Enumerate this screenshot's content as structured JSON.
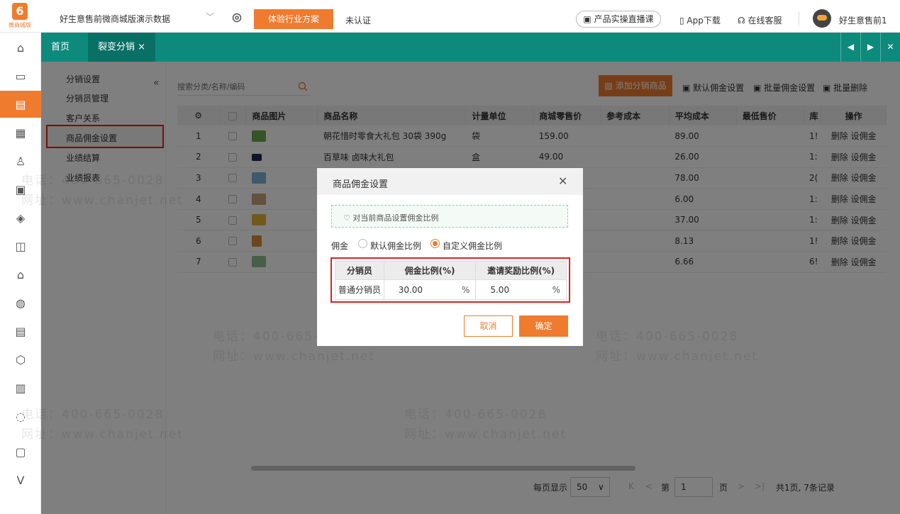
{
  "top": {
    "logo_text": "微商城版",
    "shop_name": "好生意售前微商城版演示数据",
    "industry_button": "体验行业方案",
    "cert_status": "未认证",
    "live_course": "产品实操直播课",
    "app_download": "App下载",
    "online_service": "在线客服",
    "username": "好生意售前1"
  },
  "tabs": [
    {
      "label": "首页"
    },
    {
      "label": "裂变分销"
    }
  ],
  "submenu": [
    {
      "label": "分销设置"
    },
    {
      "label": "分销员管理"
    },
    {
      "label": "客户关系"
    },
    {
      "label": "商品佣金设置"
    },
    {
      "label": "业绩结算"
    },
    {
      "label": "业绩报表"
    }
  ],
  "toolbar": {
    "search_placeholder": "搜索分类/名称/编码",
    "add_button": "添加分销商品",
    "default_commission": "默认佣金设置",
    "batch_commission": "批量佣金设置",
    "batch_delete": "批量删除"
  },
  "table": {
    "headers": [
      "商品图片",
      "商品名称",
      "计量单位",
      "商城零售价",
      "参考成本",
      "平均成本",
      "最低售价",
      "库",
      "操作"
    ],
    "rows": [
      {
        "no": "1",
        "name": "朝花惜时零食大礼包 30袋 390g",
        "unit": "袋",
        "price": "159.00",
        "avg": "89.00",
        "stock": "1!",
        "del": "删除",
        "set": "设佣金"
      },
      {
        "no": "2",
        "name": "百草味 卤味大礼包",
        "unit": "盒",
        "price": "49.00",
        "avg": "26.00",
        "stock": "1:",
        "del": "删除",
        "set": "设佣金"
      },
      {
        "no": "3",
        "name": "",
        "unit": "",
        "price": "",
        "avg": "78.00",
        "stock": "2(",
        "del": "删除",
        "set": "设佣金"
      },
      {
        "no": "4",
        "name": "",
        "unit": "",
        "price": "",
        "avg": "6.00",
        "stock": "1:",
        "del": "删除",
        "set": "设佣金"
      },
      {
        "no": "5",
        "name": "",
        "unit": "",
        "price": "",
        "avg": "37.00",
        "stock": "1:",
        "del": "删除",
        "set": "设佣金"
      },
      {
        "no": "6",
        "name": "",
        "unit": "",
        "price": "",
        "avg": "8.13",
        "stock": "1!",
        "del": "删除",
        "set": "设佣金"
      },
      {
        "no": "7",
        "name": "",
        "unit": "",
        "price": "",
        "avg": "6.66",
        "stock": "6!",
        "del": "删除",
        "set": "设佣金"
      }
    ]
  },
  "pager": {
    "per_page_label": "每页显示",
    "per_page": "50",
    "page_prefix": "第",
    "page": "1",
    "page_suffix": "页",
    "summary": "共1页, 7条记录"
  },
  "modal": {
    "title": "商品佣金设置",
    "tip": "对当前商品设置佣金比例",
    "commission_label": "佣金",
    "option_default": "默认佣金比例",
    "option_custom": "自定义佣金比例",
    "selected": "option_custom",
    "headers": [
      "分销员",
      "佣金比例(%)",
      "邀请奖励比例(%)"
    ],
    "row": {
      "role": "普通分销员",
      "rate": "30.00",
      "rate_unit": "%",
      "invite": "5.00",
      "invite_unit": "%"
    },
    "cancel": "取消",
    "confirm": "确定"
  },
  "watermark": {
    "phone": "电话：400-665-0028",
    "site": "网址：www.chanjet.net"
  },
  "colors": {
    "accent": "#ef7b2f",
    "tab_bar": "#0e8a7d",
    "highlight_border": "#e02020"
  }
}
